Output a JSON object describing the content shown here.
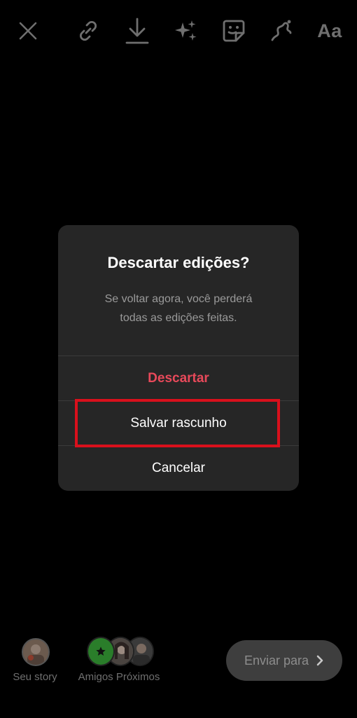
{
  "toolbar": {
    "items": [
      {
        "icon": "close-icon"
      },
      {
        "icon": "link-icon"
      },
      {
        "icon": "download-icon"
      },
      {
        "icon": "effects-sparkle-icon"
      },
      {
        "icon": "sticker-icon"
      },
      {
        "icon": "draw-icon"
      },
      {
        "icon": "text-icon",
        "label": "Aa"
      }
    ]
  },
  "dialog": {
    "title": "Descartar edições?",
    "message_line1": "Se voltar agora, você perderá",
    "message_line2": "todas as edições feitas.",
    "discard_label": "Descartar",
    "save_draft_label": "Salvar rascunho",
    "cancel_label": "Cancelar"
  },
  "bottom": {
    "your_story_label": "Seu story",
    "close_friends_label": "Amigos Próximos",
    "send_label": "Enviar para"
  },
  "colors": {
    "background": "#000000",
    "dialog_bg": "#262626",
    "discard_red": "#e8495a",
    "highlight_red": "#d9101c",
    "close_friends_green": "#2a7d2a"
  }
}
